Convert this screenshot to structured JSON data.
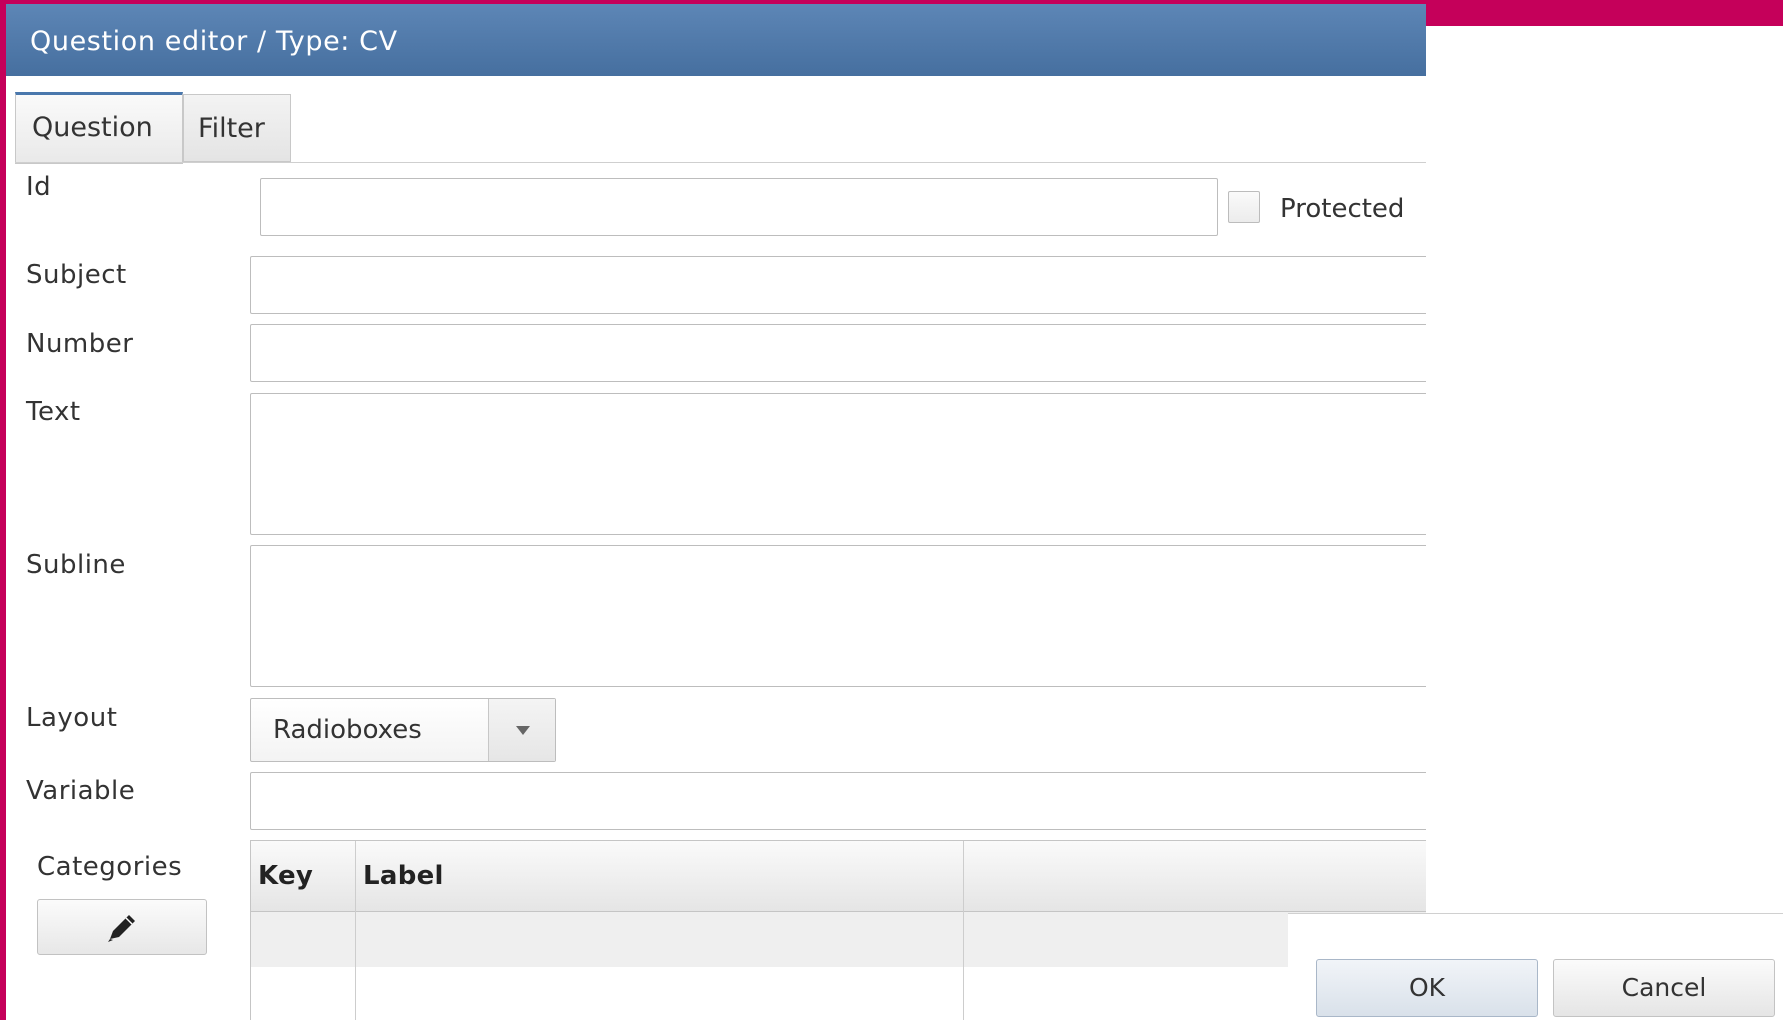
{
  "dialog": {
    "title": "Question editor / Type: CV"
  },
  "tabs": [
    {
      "label": "Question",
      "active": true
    },
    {
      "label": "Filter",
      "active": false
    }
  ],
  "form": {
    "id": {
      "label": "Id",
      "value": ""
    },
    "protected": {
      "label": "Protected",
      "checked": false
    },
    "subject": {
      "label": "Subject",
      "value": ""
    },
    "number": {
      "label": "Number",
      "value": ""
    },
    "text": {
      "label": "Text",
      "value": ""
    },
    "subline": {
      "label": "Subline",
      "value": ""
    },
    "layout": {
      "label": "Layout",
      "value": "Radioboxes"
    },
    "variable": {
      "label": "Variable",
      "value": ""
    }
  },
  "categories": {
    "label": "Categories",
    "edit_icon": "pencil-icon",
    "columns": [
      "Key",
      "Label"
    ],
    "rows": []
  },
  "buttons": {
    "ok": "OK",
    "cancel": "Cancel"
  },
  "colors": {
    "accent": "#c5005a",
    "titlebar": "#4f78a8"
  }
}
